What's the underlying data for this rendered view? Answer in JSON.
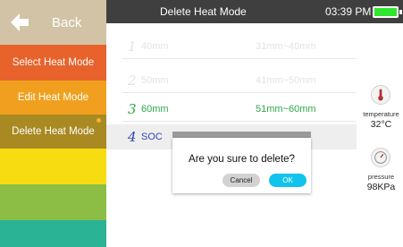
{
  "sidebar": {
    "back_label": "Back",
    "items": [
      {
        "label": "Select Heat Mode"
      },
      {
        "label": "Edit Heat Mode"
      },
      {
        "label": "Delete Heat Mode"
      },
      {
        "label": ""
      },
      {
        "label": ""
      },
      {
        "label": ""
      }
    ]
  },
  "header": {
    "title": "Delete Heat Mode",
    "time": "03:39 PM",
    "battery_color": "#2ee62e"
  },
  "list": {
    "rows": [
      {
        "index": "1",
        "name": "40mm",
        "range": "31mm~40mm"
      },
      {
        "index": "2",
        "name": "50mm",
        "range": "41mm~50mm"
      },
      {
        "index": "3",
        "name": "60mm",
        "range": "51mm~60mm"
      },
      {
        "index": "4",
        "name": "SOC",
        "range": ""
      }
    ]
  },
  "sensors": {
    "temperature_label": "temperature",
    "temperature_value": "32°C",
    "pressure_label": "pressure",
    "pressure_value": "98KPa"
  },
  "dialog": {
    "message": "Are you sure to delete?",
    "cancel_label": "Cancel",
    "ok_label": "OK"
  },
  "colors": {
    "sidebar": [
      "#e8622b",
      "#f0a01e",
      "#a88922",
      "#f7dc12",
      "#8cbe45",
      "#2bb396"
    ],
    "back": "#d2c3a6",
    "accent_ok": "#12c4ec"
  },
  "icons": {
    "back": "back-arrow-icon",
    "temperature": "thermometer-icon",
    "pressure": "pressure-gauge-icon",
    "battery": "battery-icon"
  }
}
